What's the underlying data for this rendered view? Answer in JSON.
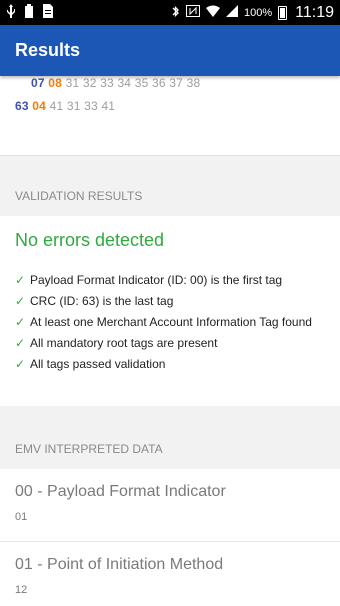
{
  "status_bar": {
    "battery_percent": "100%",
    "time": "11:19",
    "icons": [
      "usb-icon",
      "battery-saver-icon",
      "document-icon",
      "bluetooth-icon",
      "nfc-icon",
      "wifi-icon",
      "signal-icon",
      "battery-icon"
    ]
  },
  "app_bar": {
    "title": "Results"
  },
  "hex_dump": {
    "line1": {
      "tag": "07",
      "length": "08",
      "data": "31 32 33 34 35 36 37 38"
    },
    "line2": {
      "tag": "63",
      "length": "04",
      "data": "41 31 33 41"
    }
  },
  "validation": {
    "header": "VALIDATION RESULTS",
    "status": "No errors detected",
    "checks": [
      "Payload Format Indicator (ID: 00) is the first tag",
      "CRC (ID: 63) is the last tag",
      "At least one Merchant Account Information Tag found",
      "All mandatory root tags are present",
      "All tags passed validation"
    ]
  },
  "emv": {
    "header": "EMV INTERPRETED DATA",
    "items": [
      {
        "title": "00 - Payload Format Indicator",
        "value": "01"
      },
      {
        "title": "01 - Point of Initiation Method",
        "value": "12"
      }
    ]
  },
  "colors": {
    "app_bar": "#1c57b6",
    "success": "#2eaa3e",
    "tag_blue": "#3f51b5",
    "length_orange": "#f57c00"
  }
}
